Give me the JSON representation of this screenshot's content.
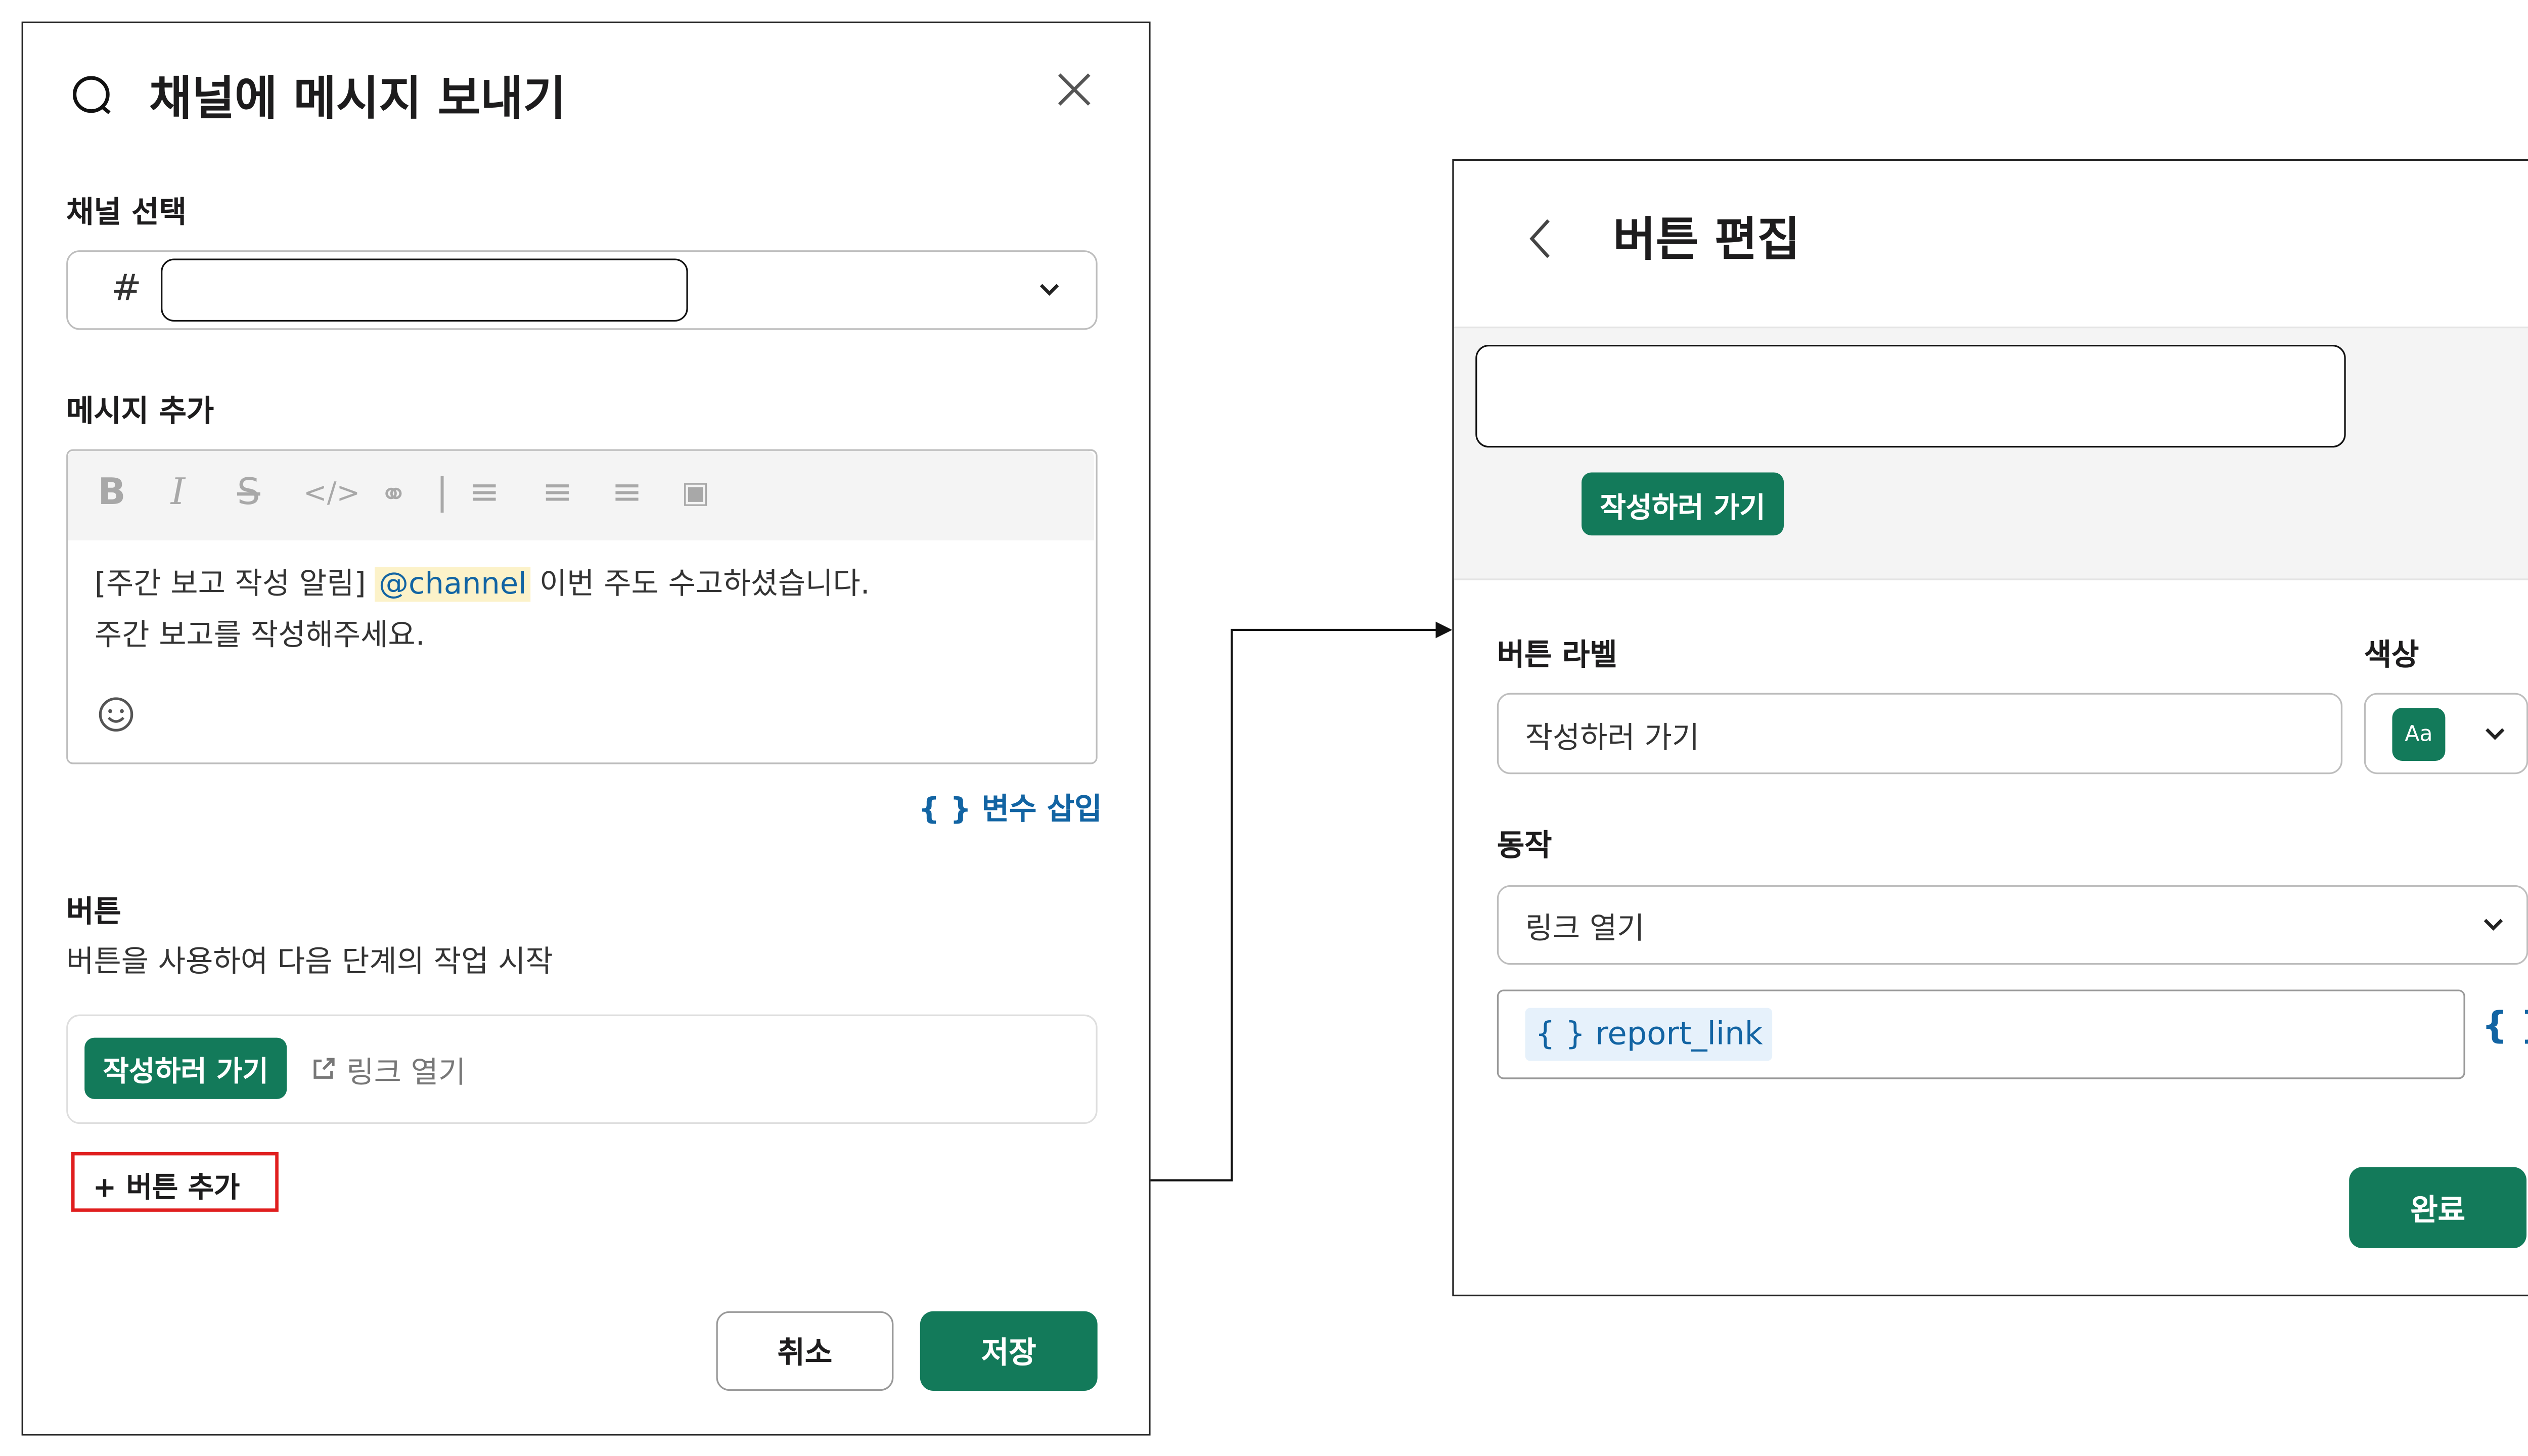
{
  "left_dialog": {
    "title": "채널에 메시지 보내기",
    "channel_label": "채널 선택",
    "channel_prefix": "#",
    "message_label": "메시지 추가",
    "message": {
      "line1_before": "[주간 보고 작성 알림] ",
      "mention": "@channel",
      "line1_after": " 이번 주도 수고하셨습니다.",
      "line2": "주간 보고를 작성해주세요."
    },
    "insert_variable": "{ } 변수 삽입",
    "button_section_title": "버튼",
    "button_section_desc": "버튼을 사용하여 다음 단계의 작업 시작",
    "button_chip_label": "작성하러 가기",
    "button_chip_action": "링크 열기",
    "add_button": "+ 버튼 추가",
    "cancel": "취소",
    "save": "저장"
  },
  "right_dialog": {
    "title": "버튼 편집",
    "preview_button": "작성하러 가기",
    "label_title": "버튼 라벨",
    "color_title": "색상",
    "label_value": "작성하러 가기",
    "color_swatch_text": "Aa",
    "action_title": "동작",
    "action_value": "링크 열기",
    "link_variable": "{ } report_link",
    "variable_icon_text": "{ }",
    "done": "완료"
  },
  "colors": {
    "brand_green": "#137a5a",
    "mention_bg": "#fcf2c9",
    "link_blue": "#1264a3",
    "highlight_red": "#e01e1e"
  }
}
